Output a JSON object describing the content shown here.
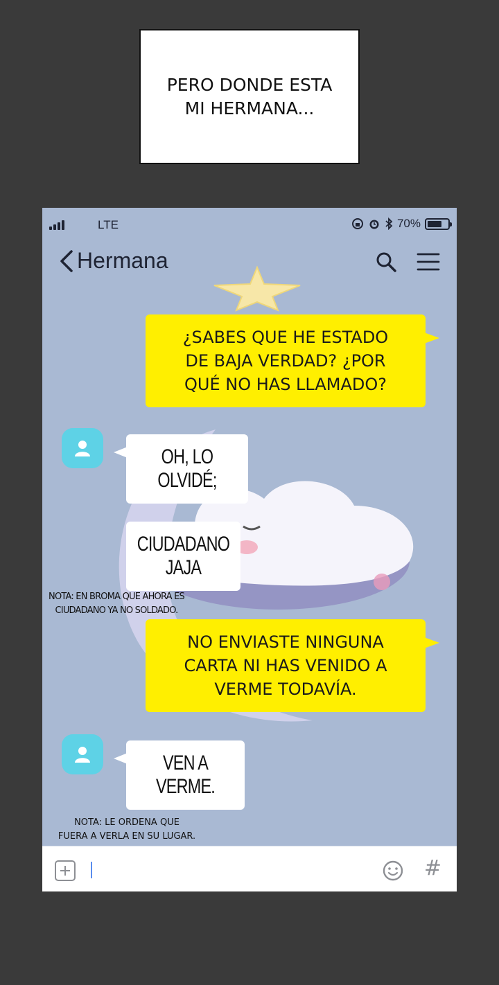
{
  "caption": {
    "line1": "PERO DONDE ESTA",
    "line2": "MI HERMANA..."
  },
  "status_bar": {
    "carrier": "LTE",
    "battery": "70%",
    "icons": [
      "signal-icon",
      "rotation-lock-icon",
      "alarm-icon",
      "bluetooth-icon",
      "battery-icon"
    ]
  },
  "header": {
    "back_icon": "chevron-left-icon",
    "title": "Hermana",
    "icons": [
      "search-icon",
      "menu-icon"
    ]
  },
  "messages": [
    {
      "side": "sent",
      "lines": [
        "¿SABES QUE HE ESTADO",
        "DE BAJA VERDAD? ¿POR",
        "QUÉ NO HAS LLAMADO?"
      ]
    },
    {
      "side": "received",
      "text": "OH, LO OLVIDÉ;"
    },
    {
      "side": "received",
      "text": "CIUDADANO JAJA"
    },
    {
      "side": "sent",
      "lines": [
        "NO ENVIASTE NINGUNA",
        "CARTA NI HAS VENIDO A",
        "VERME TODAVÍA."
      ]
    },
    {
      "side": "received",
      "text": "VEN A VERME."
    }
  ],
  "notes": [
    {
      "lines": [
        "NOTA: EN BROMA QUE AHORA ES",
        "CIUDADANO YA NO SOLDADO."
      ]
    },
    {
      "lines": [
        "NOTA: LE ORDENA QUE",
        "FUERA A VERLA EN SU LUGAR."
      ]
    }
  ],
  "composer": {
    "value": "",
    "hash": "#"
  },
  "colors": {
    "page_background": "#3a3a3a",
    "chat_background": "#a9b9d3",
    "sent_bubble": "#ffef00",
    "received_bubble": "#ffffff",
    "avatar": "#5ed2e6"
  }
}
